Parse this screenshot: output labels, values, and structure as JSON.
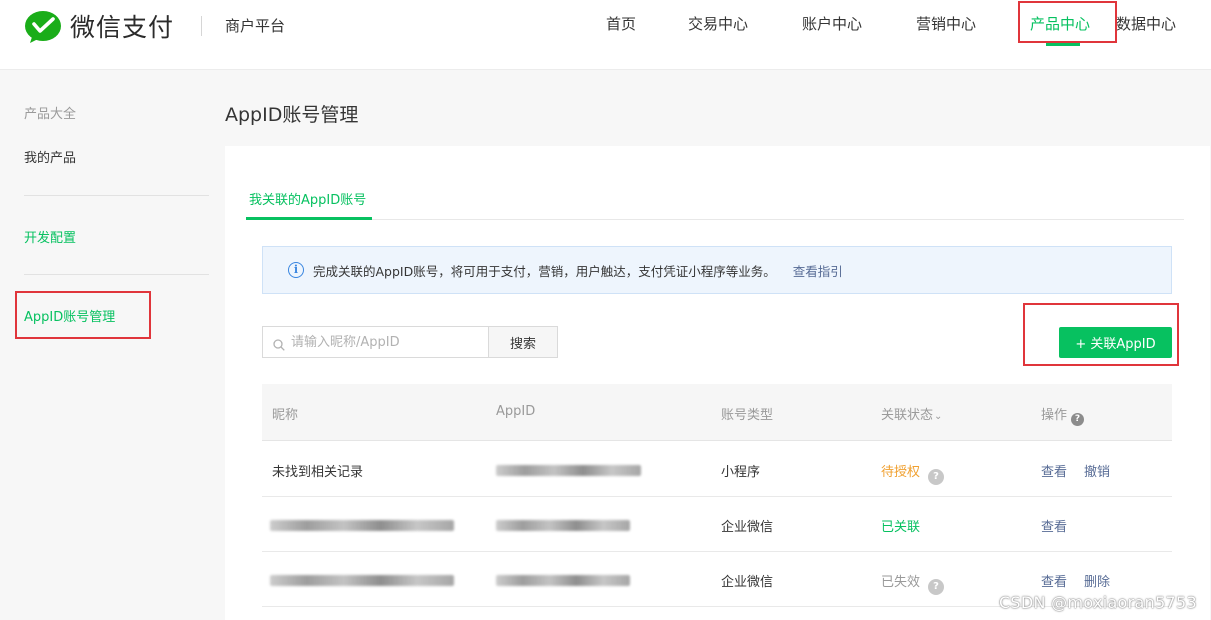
{
  "header": {
    "brand": "微信支付",
    "platform": "商户平台",
    "nav": [
      "首页",
      "交易中心",
      "账户中心",
      "营销中心",
      "产品中心",
      "数据中心"
    ],
    "active_nav": "产品中心"
  },
  "sidebar": {
    "section_title": "产品大全",
    "items": [
      {
        "label": "我的产品"
      },
      {
        "label": "开发配置"
      },
      {
        "label": "AppID账号管理"
      }
    ]
  },
  "main": {
    "title": "AppID账号管理",
    "tab": "我关联的AppID账号",
    "notice": {
      "text": "完成关联的AppID账号，将可用于支付，营销，用户触达，支付凭证小程序等业务。",
      "link": "查看指引"
    },
    "search": {
      "placeholder": "请输入昵称/AppID",
      "button": "搜索"
    },
    "add_button": "+ 关联AppID",
    "table": {
      "columns": [
        "昵称",
        "AppID",
        "账号类型",
        "关联状态",
        "操作"
      ],
      "rows": [
        {
          "nickname": "未找到相关记录",
          "appid": "",
          "type": "小程序",
          "status": "待授权",
          "actions": [
            "查看",
            "撤销"
          ]
        },
        {
          "nickname": "",
          "appid": "",
          "type": "企业微信",
          "status": "已关联",
          "actions": [
            "查看"
          ]
        },
        {
          "nickname": "",
          "appid": "",
          "type": "企业微信",
          "status": "已失效",
          "actions": [
            "查看",
            "删除"
          ]
        }
      ]
    }
  },
  "watermark": "CSDN @moxiaoran5753",
  "colors": {
    "accent": "#07c160",
    "link": "#576b95",
    "pending": "#f0a030",
    "highlight_box": "#e0353b"
  }
}
